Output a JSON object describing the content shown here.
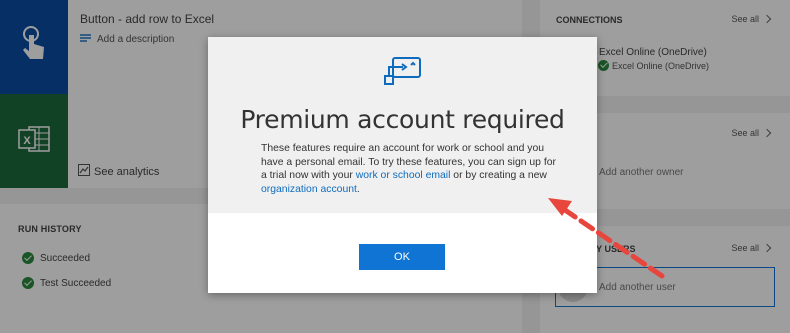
{
  "flow": {
    "title": "Button - add row to Excel",
    "add_description": "Add a description",
    "see_analytics": "See analytics"
  },
  "run_history": {
    "title": "RUN HISTORY",
    "items": [
      "Succeeded",
      "Test Succeeded"
    ]
  },
  "connections": {
    "title": "CONNECTIONS",
    "see_all": "See all",
    "name": "Excel Online (OneDrive)",
    "status": "Excel Online (OneDrive)"
  },
  "owners": {
    "see_all": "See all",
    "add_owner": "Add another owner"
  },
  "run_only_users": {
    "title": "RUN ONLY USERS",
    "see_all": "See all",
    "add_user": "Add another user"
  },
  "dialog": {
    "title": "Premium account required",
    "body_prefix": "These features require an account for work or school and you have a personal email. To try these features, you can sign up for a trial now with your ",
    "link1": "work or school email",
    "body_middle": " or by creating a new ",
    "link2": "organization account",
    "body_suffix": ".",
    "ok_label": "OK"
  },
  "colors": {
    "accent": "#0f74d4",
    "annotation": "#e8453c",
    "flow_tile": "#0a4da3",
    "excel_tile": "#1e6b3c"
  }
}
